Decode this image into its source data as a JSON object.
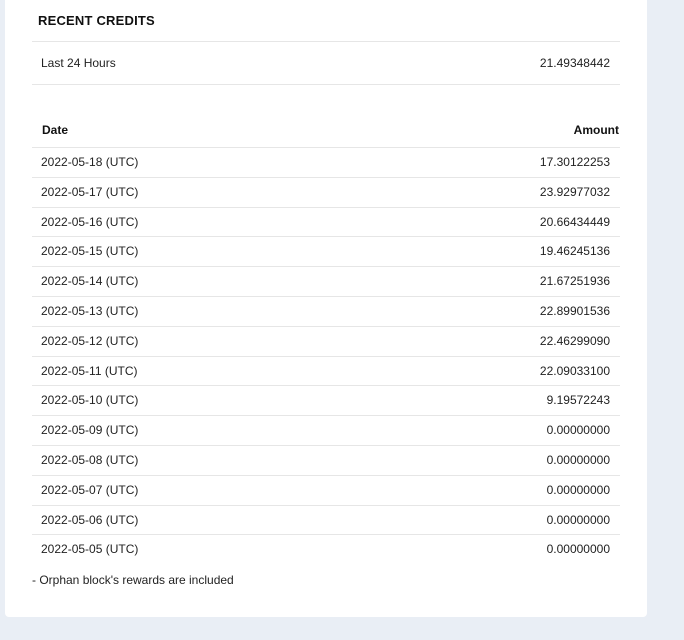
{
  "panel": {
    "title": "RECENT CREDITS",
    "summary": {
      "label": "Last 24 Hours",
      "value": "21.49348442"
    }
  },
  "table": {
    "headers": {
      "date": "Date",
      "amount": "Amount"
    },
    "rows": [
      {
        "date": "2022-05-18 (UTC)",
        "amount": "17.30122253"
      },
      {
        "date": "2022-05-17 (UTC)",
        "amount": "23.92977032"
      },
      {
        "date": "2022-05-16 (UTC)",
        "amount": "20.66434449"
      },
      {
        "date": "2022-05-15 (UTC)",
        "amount": "19.46245136"
      },
      {
        "date": "2022-05-14 (UTC)",
        "amount": "21.67251936"
      },
      {
        "date": "2022-05-13 (UTC)",
        "amount": "22.89901536"
      },
      {
        "date": "2022-05-12 (UTC)",
        "amount": "22.46299090"
      },
      {
        "date": "2022-05-11 (UTC)",
        "amount": "22.09033100"
      },
      {
        "date": "2022-05-10 (UTC)",
        "amount": "9.19572243"
      },
      {
        "date": "2022-05-09 (UTC)",
        "amount": "0.00000000"
      },
      {
        "date": "2022-05-08 (UTC)",
        "amount": "0.00000000"
      },
      {
        "date": "2022-05-07 (UTC)",
        "amount": "0.00000000"
      },
      {
        "date": "2022-05-06 (UTC)",
        "amount": "0.00000000"
      },
      {
        "date": "2022-05-05 (UTC)",
        "amount": "0.00000000"
      }
    ]
  },
  "footnote": "- Orphan block's rewards are included"
}
